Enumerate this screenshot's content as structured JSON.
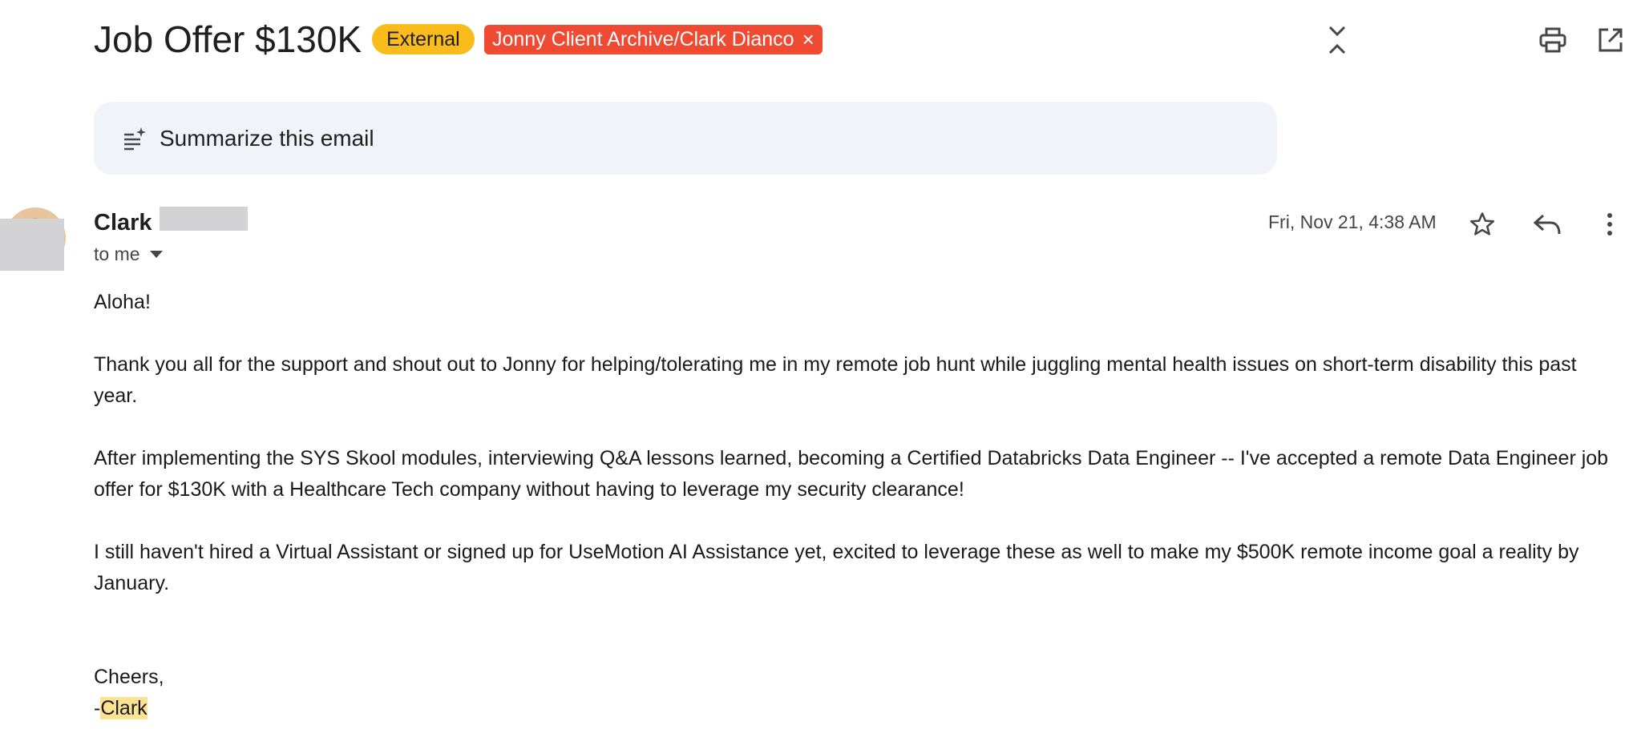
{
  "email": {
    "subject": "Job Offer $130K",
    "external_label": "External",
    "folder_label": "Jonny Client Archive/Clark Dianco",
    "folder_label_close": "×"
  },
  "header_icons": [
    "expand-collapse-icon",
    "print-icon",
    "open-in-new-window-icon"
  ],
  "summarize": {
    "label": "Summarize this email"
  },
  "message": {
    "sender_name": "Clark",
    "recipient_label": "to me",
    "date": "Fri, Nov 21, 4:38 AM",
    "icons": [
      "star-icon",
      "reply-icon",
      "more-vert-icon"
    ],
    "body": {
      "greeting": "Aloha!",
      "para1": "Thank you all for the support and shout out to Jonny for helping/tolerating me in my remote job hunt while juggling mental health issues on short-term disability this past year.",
      "para2": "After implementing the SYS Skool modules, interviewing Q&A lessons learned, becoming a Certified Databricks Data Engineer -- I've accepted a remote Data Engineer job offer for $130K with a Healthcare Tech company without having to leverage my security clearance!",
      "para3": "I still haven't hired a Virtual Assistant or signed up for UseMotion AI Assistance yet, excited to leverage these as well to make my $500K remote income goal a reality by January.",
      "closing": "Cheers,",
      "signature_dash": "-",
      "signature_name": "Clark"
    }
  },
  "colors": {
    "external_chip": "#f9bc1b",
    "folder_chip": "#f04a33",
    "summarize_bg": "#f0f4f9",
    "highlight": "#fde293"
  }
}
